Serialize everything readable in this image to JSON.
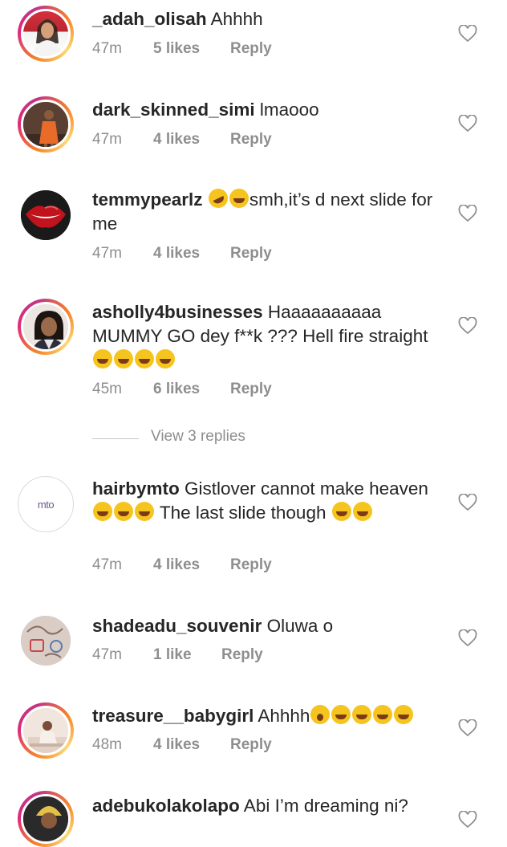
{
  "comments": [
    {
      "username": "_adah_olisah",
      "text": " Ahhhh",
      "time": "47m",
      "likes": "5 likes",
      "reply": "Reply",
      "avatar": "profile-photo-woman-white-top-icon",
      "ring": "story"
    },
    {
      "username": "dark_skinned_simi",
      "text": " lmaooo",
      "time": "47m",
      "likes": "4 likes",
      "reply": "Reply",
      "avatar": "profile-photo-woman-orange-dress-icon",
      "ring": "story"
    },
    {
      "username": "temmypearlz",
      "text_after_emoji": "smh,it’s d next slide for me",
      "time": "47m",
      "likes": "4 likes",
      "reply": "Reply",
      "avatar": "profile-photo-red-lips-icon",
      "ring": "none"
    },
    {
      "username": "asholly4businesses",
      "text": " Haaaaaaaaaa MUMMY GO dey f**k ??? Hell fire straight ",
      "time": "45m",
      "likes": "6 likes",
      "reply": "Reply",
      "avatar": "profile-photo-woman-icon",
      "ring": "story"
    },
    {
      "username": "hairbymto",
      "text": " Gistlover cannot make heaven",
      "text_2": " The last slide though ",
      "time": "47m",
      "likes": "4 likes",
      "reply": "Reply",
      "avatar_text": "mto",
      "ring": "plain"
    },
    {
      "username": "shadeadu_souvenir",
      "text": " Oluwa o",
      "time": "47m",
      "likes": "1 like",
      "reply": "Reply",
      "avatar": "profile-photo-souvenir-icon",
      "ring": "none"
    },
    {
      "username": "treasure__babygirl",
      "text": " Ahhhh",
      "time": "48m",
      "likes": "4 likes",
      "reply": "Reply",
      "avatar": "profile-photo-woman-seated-icon",
      "ring": "story"
    },
    {
      "username": "adebukolakolapo",
      "text": " Abi I’m dreaming ni?",
      "avatar": "profile-photo-woman-headwrap-icon",
      "ring": "story"
    }
  ],
  "view_replies": "View 3 replies",
  "colors": {
    "text": "#262626",
    "secondary": "#8e8e8e",
    "ring_start": "#f58529",
    "ring_mid": "#dd2a7b",
    "emoji": "#f6c41e"
  },
  "icons": {
    "like": "heart-outline-icon",
    "emoji_laugh": "face-with-tears-of-joy-icon",
    "emoji_rofl": "rolling-on-floor-laughing-icon",
    "emoji_wow": "face-with-open-mouth-icon"
  }
}
